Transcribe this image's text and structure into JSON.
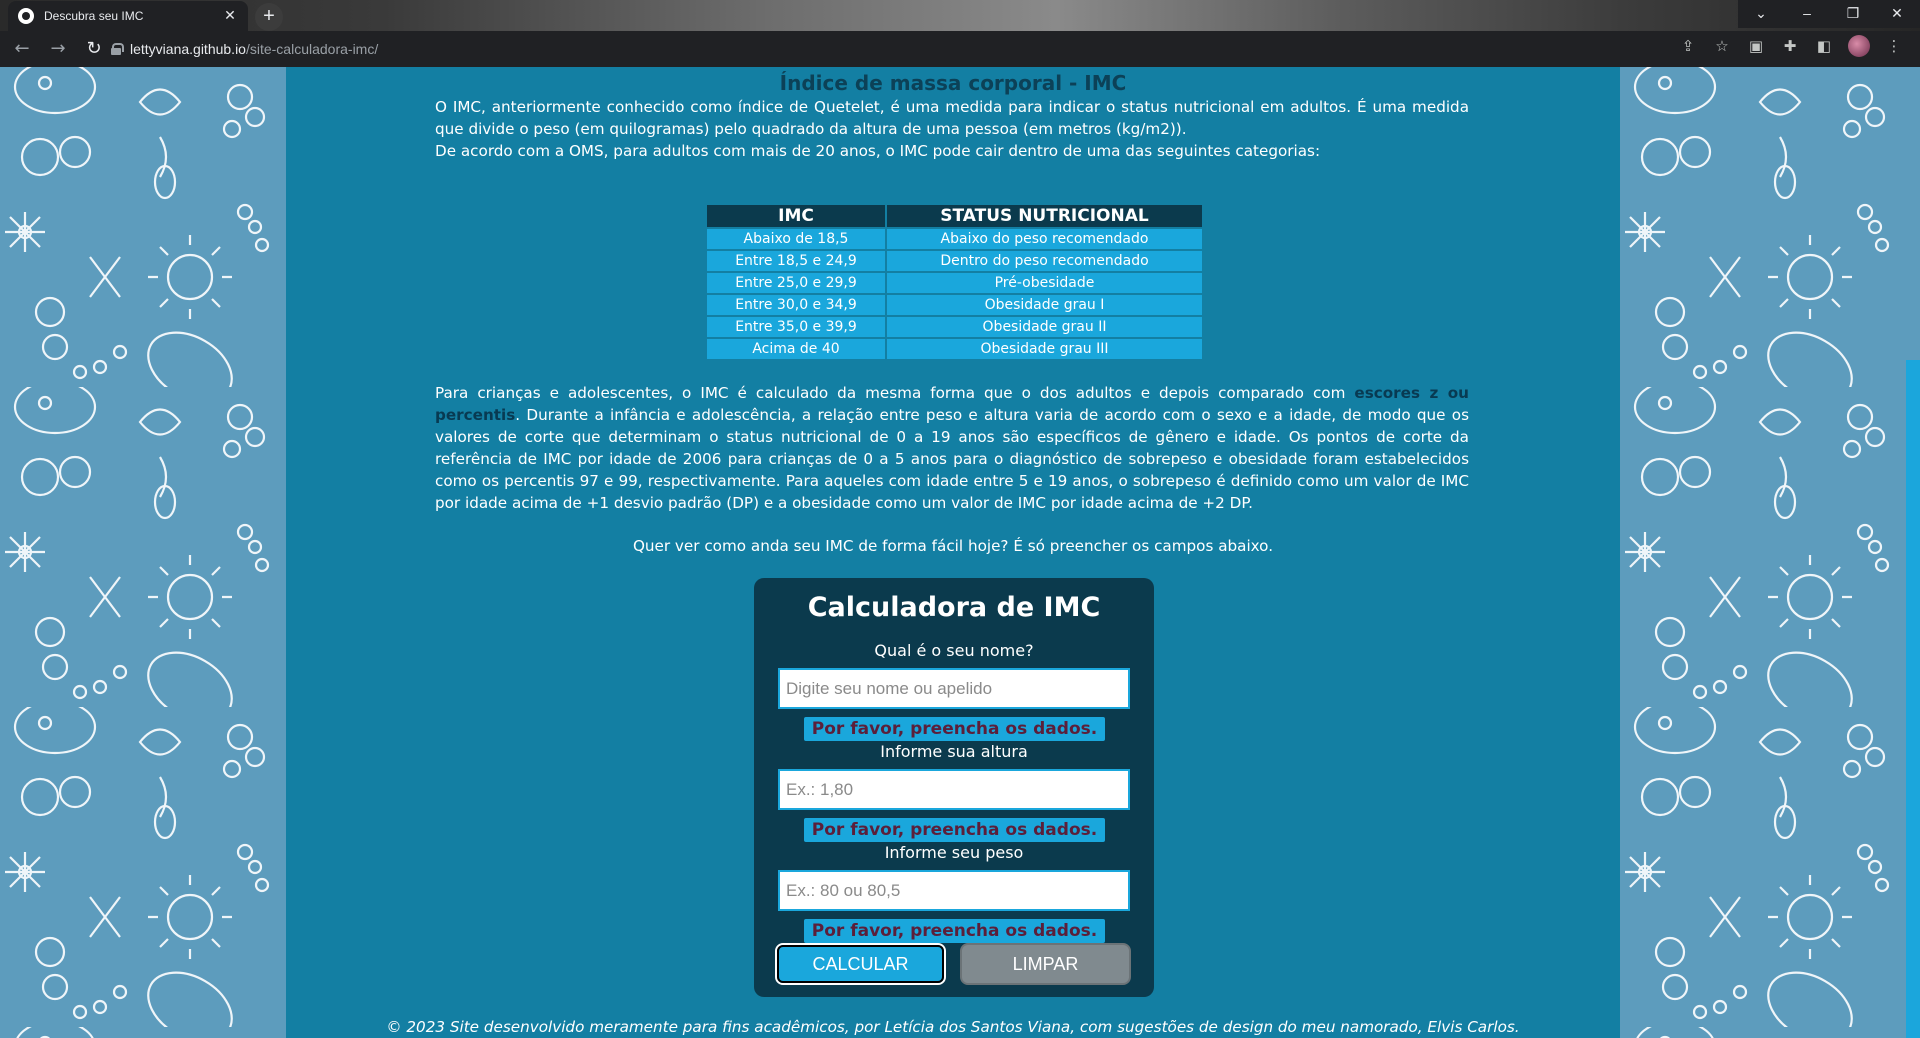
{
  "browser": {
    "tab_title": "Descubra seu IMC",
    "url_host": "lettyviana.github.io",
    "url_path": "/site-calculadora-imc/"
  },
  "page": {
    "heading": "Índice de massa corporal - IMC",
    "intro_lines": [
      "O IMC, anteriormente conhecido como índice de Quetelet, é uma medida para indicar o status nutricional em adultos. É uma medida que divide o peso (em quilogramas) pelo quadrado da altura de uma pessoa (em metros (kg/m2)).",
      "De acordo com a OMS, para adultos com mais de 20 anos, o IMC pode cair dentro de uma das seguintes categorias:"
    ],
    "table": {
      "headers": [
        "IMC",
        "STATUS NUTRICIONAL"
      ],
      "rows": [
        [
          "Abaixo de 18,5",
          "Abaixo do peso recomendado"
        ],
        [
          "Entre 18,5 e 24,9",
          "Dentro do peso recomendado"
        ],
        [
          "Entre 25,0 e 29,9",
          "Pré-obesidade"
        ],
        [
          "Entre 30,0 e 34,9",
          "Obesidade grau I"
        ],
        [
          "Entre 35,0 e 39,9",
          "Obesidade grau II"
        ],
        [
          "Acima de 40",
          "Obesidade grau III"
        ]
      ]
    },
    "children_before_link": "Para crianças e adolescentes, o IMC é calculado da mesma forma que o dos adultos e depois comparado com ",
    "children_link": "escores z ou percentis",
    "children_after_link": ". Durante a infância e adolescência, a relação entre peso e altura varia de acordo com o sexo e a idade, de modo que os valores de corte que determinam o status nutricional de 0 a 19 anos são específicos de gênero e idade. Os pontos de corte da referência de IMC por idade de 2006 para crianças de 0 a 5 anos para o diagnóstico de sobrepeso e obesidade foram estabelecidos como os percentis 97 e 99, respectivamente. Para aqueles com idade entre 5 e 19 anos, o sobrepeso é definido como um valor de IMC por idade acima de +1 desvio padrão (DP) e a obesidade como um valor de IMC por idade acima de +2 DP.",
    "cta": "Quer ver como anda seu IMC de forma fácil hoje? É só preencher os campos abaixo.",
    "footer": "© 2023 Site desenvolvido meramente para fins acadêmicos, por Letícia dos Santos Viana, com sugestões de design do meu namorado, Elvis Carlos."
  },
  "calculator": {
    "title": "Calculadora de IMC",
    "name_label": "Qual é o seu nome?",
    "name_placeholder": "Digite seu nome ou apelido",
    "height_label": "Informe sua altura",
    "height_placeholder": "Ex.: 1,80",
    "weight_label": "Informe seu peso",
    "weight_placeholder": "Ex.: 80 ou 80,5",
    "error_message": "Por favor, preencha os dados.",
    "calc_button": "CALCULAR",
    "clear_button": "LIMPAR"
  },
  "colors": {
    "main_bg": "#137fa3",
    "side_bg": "#5d9cbd",
    "accent": "#1aa7dc",
    "dark": "#0b3a4d",
    "error_text": "#5b1f3a"
  }
}
